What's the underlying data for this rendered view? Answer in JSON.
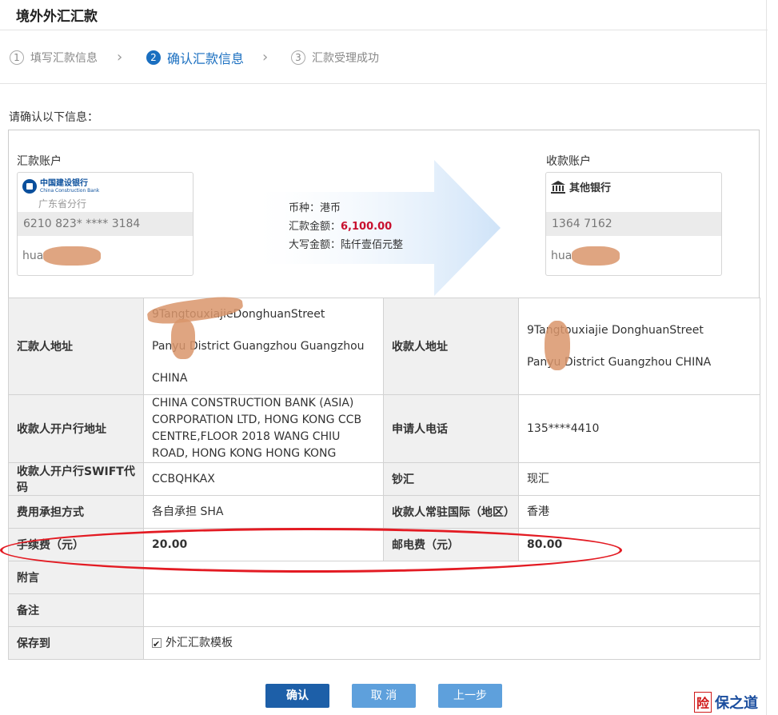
{
  "page": {
    "title": "境外外汇汇款"
  },
  "steps": [
    {
      "num": "1",
      "label": "填写汇款信息"
    },
    {
      "num": "2",
      "label": "确认汇款信息"
    },
    {
      "num": "3",
      "label": "汇款受理成功"
    }
  ],
  "step_separator": "›",
  "confirm_prompt": "请确认以下信息：",
  "payer": {
    "section_label": "汇款账户",
    "bank_name_cn": "中国建设银行",
    "bank_name_en": "China Construction Bank",
    "branch": "广东省分行",
    "account": "6210 823* **** 3184",
    "holder": "hua"
  },
  "payee": {
    "section_label": "收款账户",
    "bank_name": "其他银行",
    "account": "1364 7162",
    "holder": "hua"
  },
  "transfer": {
    "currency_label": "币种：",
    "currency": "港币",
    "amount_label": "汇款金额：",
    "amount": "6,100.00",
    "amount_words_label": "大写金额：",
    "amount_words": "陆仟壹佰元整"
  },
  "details": {
    "remitter_address_label": "汇款人地址",
    "remitter_address": [
      "9TangtouxiajieDonghuanStreet",
      "Panyu District Guangzhou Guangzhou",
      "CHINA"
    ],
    "payee_address_label": "收款人地址",
    "payee_address": [
      "9Tangtouxiajie DonghuanStreet",
      "Panyu District Guangzhou CHINA"
    ],
    "payee_bank_address_label": "收款人开户行地址",
    "payee_bank_address": "CHINA CONSTRUCTION BANK (ASIA) CORPORATION LTD, HONG KONG   CCB CENTRE,FLOOR 2018 WANG CHIU ROAD, HONG KONG HONG KONG",
    "applicant_phone_label": "申请人电话",
    "applicant_phone": "135****4410",
    "swift_label": "收款人开户行SWIFT代码",
    "swift": "CCBQHKAX",
    "cash_type_label": "钞汇",
    "cash_type": "现汇",
    "fee_bearer_label": "费用承担方式",
    "fee_bearer": "各自承担 SHA",
    "payee_country_label": "收款人常驻国际（地区）",
    "payee_country": "香港",
    "handling_fee_label": "手续费（元）",
    "handling_fee": "20.00",
    "postage_fee_label": "邮电费（元）",
    "postage_fee": "80.00",
    "postscript_label": "附言",
    "postscript": "",
    "remark_label": "备注",
    "remark": "",
    "save_to_label": "保存到",
    "save_to_option": "外汇汇款模板",
    "save_to_checked": true
  },
  "buttons": {
    "confirm": "确认",
    "cancel": "取 消",
    "prev": "上一步"
  },
  "watermark": {
    "seal": "险",
    "text": "保之道"
  },
  "colors": {
    "accent": "#1a6fc0",
    "amount_red": "#c8102e",
    "annotation": "#e31b23",
    "button_primary": "#1d5fa8",
    "button_secondary": "#5ea0dc"
  }
}
